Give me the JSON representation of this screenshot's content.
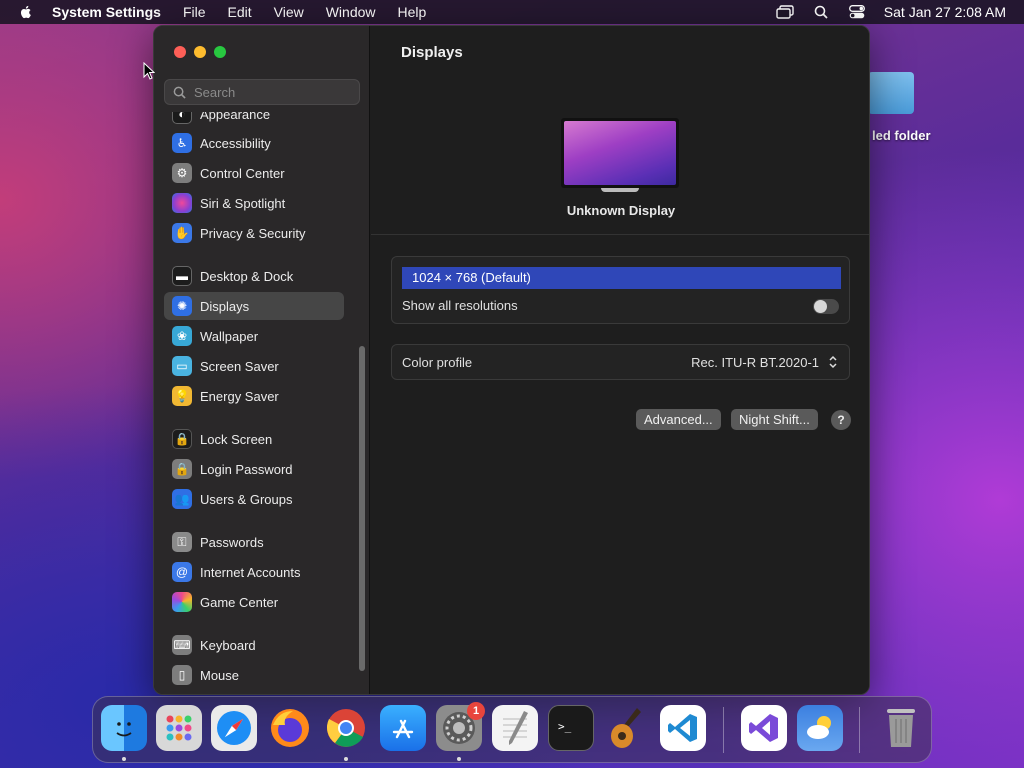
{
  "menubar": {
    "app_name": "System Settings",
    "items": [
      "File",
      "Edit",
      "View",
      "Window",
      "Help"
    ],
    "clock": "Sat Jan 27  2:08 AM"
  },
  "desktop": {
    "folder_label": "led folder"
  },
  "sidebar": {
    "search_placeholder": "Search",
    "items": [
      {
        "label": "Appearance",
        "icon": "appearance-icon",
        "color": "#1a1a1a"
      },
      {
        "label": "Accessibility",
        "icon": "accessibility-icon",
        "color": "#2f6fe4"
      },
      {
        "label": "Control Center",
        "icon": "control-center-icon",
        "color": "#7d7d7d"
      },
      {
        "label": "Siri & Spotlight",
        "icon": "siri-icon",
        "color": "#8a3fd1"
      },
      {
        "label": "Privacy & Security",
        "icon": "privacy-hand-icon",
        "color": "#3b78e7"
      },
      {
        "label": "Desktop & Dock",
        "icon": "desktop-dock-icon",
        "color": "#1c1c1c"
      },
      {
        "label": "Displays",
        "icon": "displays-icon",
        "color": "#2f6fe4"
      },
      {
        "label": "Wallpaper",
        "icon": "wallpaper-icon",
        "color": "#38a8d6"
      },
      {
        "label": "Screen Saver",
        "icon": "screen-saver-icon",
        "color": "#4ab3e0"
      },
      {
        "label": "Energy Saver",
        "icon": "energy-saver-icon",
        "color": "#f1b833"
      },
      {
        "label": "Lock Screen",
        "icon": "lock-icon",
        "color": "#1c1c1c"
      },
      {
        "label": "Login Password",
        "icon": "login-lock-icon",
        "color": "#7d7d7d"
      },
      {
        "label": "Users & Groups",
        "icon": "users-icon",
        "color": "#2f6fe4"
      },
      {
        "label": "Passwords",
        "icon": "key-icon",
        "color": "#8a8a8a"
      },
      {
        "label": "Internet Accounts",
        "icon": "at-icon",
        "color": "#3b78e7"
      },
      {
        "label": "Game Center",
        "icon": "game-center-icon",
        "color": "#ffffff"
      },
      {
        "label": "Keyboard",
        "icon": "keyboard-icon",
        "color": "#7d7d7d"
      },
      {
        "label": "Mouse",
        "icon": "mouse-icon",
        "color": "#7d7d7d"
      }
    ],
    "active": "Displays"
  },
  "main": {
    "title": "Displays",
    "display_name": "Unknown Display",
    "resolution_selected": "1024 × 768 (Default)",
    "show_all_label": "Show all resolutions",
    "show_all_enabled": false,
    "color_profile_label": "Color profile",
    "color_profile_value": "Rec. ITU-R BT.2020-1",
    "advanced_button": "Advanced...",
    "night_shift_button": "Night Shift...",
    "help_label": "?"
  },
  "dock": {
    "apps": [
      {
        "name": "Finder",
        "icon": "finder-icon",
        "color": "#3aa0f0"
      },
      {
        "name": "Launchpad",
        "icon": "launchpad-icon",
        "color": "#d8d8d8"
      },
      {
        "name": "Safari",
        "icon": "safari-icon",
        "color": "#eaeaea"
      },
      {
        "name": "Firefox",
        "icon": "firefox-icon",
        "color": "#ff7a1a"
      },
      {
        "name": "Chrome",
        "icon": "chrome-icon",
        "color": "#ffffff"
      },
      {
        "name": "App Store",
        "icon": "app-store-icon",
        "color": "#1e8ef5"
      },
      {
        "name": "System Settings",
        "icon": "system-settings-icon",
        "color": "#8c8c8c"
      },
      {
        "name": "TextEdit",
        "icon": "textedit-icon",
        "color": "#f4f4f4"
      },
      {
        "name": "Terminal",
        "icon": "terminal-icon",
        "color": "#1a1a1a"
      },
      {
        "name": "GarageBand",
        "icon": "garageband-icon",
        "color": "#5a3a1c"
      },
      {
        "name": "VS Code",
        "icon": "vscode-icon",
        "color": "#ffffff"
      },
      {
        "name": "Visual Studio",
        "icon": "visual-studio-icon",
        "color": "#ffffff"
      },
      {
        "name": "Weather",
        "icon": "weather-icon",
        "color": "#3b7fe0"
      },
      {
        "name": "Trash",
        "icon": "trash-icon",
        "color": "#9a9a9a"
      }
    ],
    "settings_badge": "1"
  }
}
